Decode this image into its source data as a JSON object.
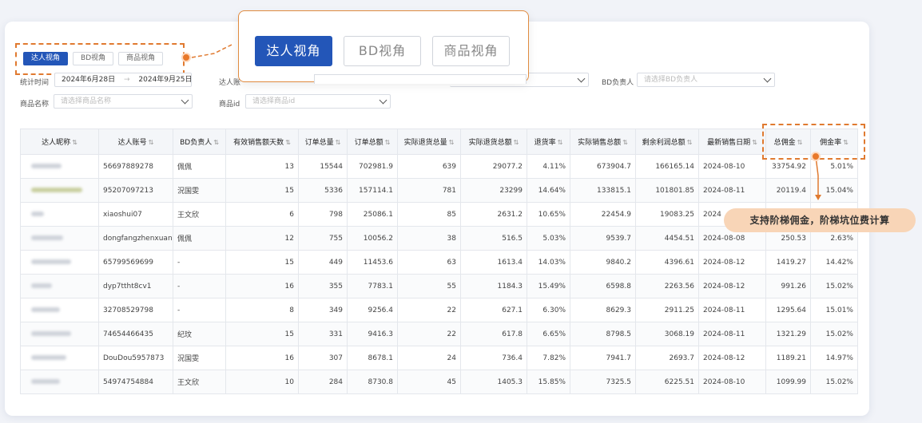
{
  "tabs": [
    {
      "label": "达人视角",
      "active": true
    },
    {
      "label": "BD视角",
      "active": false
    },
    {
      "label": "商品视角",
      "active": false
    }
  ],
  "filters": {
    "period_label": "统计时间",
    "start_date": "2024年6月28日",
    "arrow": "→",
    "end_date": "2024年9月25日",
    "talent_label": "达人账",
    "bd_label": "BD负责人",
    "bd_placeholder": "请选择BD负责人",
    "product_name_label": "商品名称",
    "product_name_placeholder": "请选择商品名称",
    "product_id_label": "商品id",
    "product_id_placeholder": "请选择商品id"
  },
  "table": {
    "headers": [
      "达人昵称",
      "达人账号",
      "BD负责人",
      "有效销售额天数",
      "订单总量",
      "订单总额",
      "实际退货总量",
      "实际退货总额",
      "退货率",
      "实际销售总额",
      "剩余利润总额",
      "最新销售日期",
      "总佣金",
      "佣金率"
    ],
    "rows": [
      [
        "56697889278",
        "佩佩",
        "13",
        "15544",
        "702981.9",
        "639",
        "29077.2",
        "4.11%",
        "673904.7",
        "166165.14",
        "2024-08-10",
        "33754.92",
        "5.01%"
      ],
      [
        "95207097213",
        "況国雯",
        "15",
        "5336",
        "157114.1",
        "781",
        "23299",
        "14.64%",
        "133815.1",
        "101801.85",
        "2024-08-11",
        "20119.4",
        "15.04%"
      ],
      [
        "xiaoshui07",
        "王文欣",
        "6",
        "798",
        "25086.1",
        "85",
        "2631.2",
        "10.65%",
        "22454.9",
        "19083.25",
        "2024",
        "",
        ""
      ],
      [
        "dongfangzhenxuan",
        "佩佩",
        "12",
        "755",
        "10056.2",
        "38",
        "516.5",
        "5.03%",
        "9539.7",
        "4454.51",
        "2024-08-08",
        "250.53",
        "2.63%"
      ],
      [
        "65799569699",
        "-",
        "15",
        "449",
        "11453.6",
        "63",
        "1613.4",
        "14.03%",
        "9840.2",
        "4396.61",
        "2024-08-12",
        "1419.27",
        "14.42%"
      ],
      [
        "dyp7ttht8cv1",
        "-",
        "16",
        "355",
        "7783.1",
        "55",
        "1184.3",
        "15.49%",
        "6598.8",
        "2263.56",
        "2024-08-12",
        "991.26",
        "15.02%"
      ],
      [
        "32708529798",
        "-",
        "8",
        "349",
        "9256.4",
        "22",
        "627.1",
        "6.30%",
        "8629.3",
        "2911.25",
        "2024-08-11",
        "1295.64",
        "15.01%"
      ],
      [
        "74654466435",
        "纪玟",
        "15",
        "331",
        "9416.3",
        "22",
        "617.8",
        "6.65%",
        "8798.5",
        "3068.19",
        "2024-08-11",
        "1321.29",
        "15.02%"
      ],
      [
        "DouDou5957873",
        "況国雯",
        "16",
        "307",
        "8678.1",
        "24",
        "736.4",
        "7.82%",
        "7941.7",
        "2693.7",
        "2024-08-12",
        "1189.21",
        "14.97%"
      ],
      [
        "54974754884",
        "王文欣",
        "10",
        "284",
        "8730.8",
        "45",
        "1405.3",
        "15.85%",
        "7325.5",
        "6225.51",
        "2024-08-10",
        "1099.99",
        "15.02%"
      ]
    ]
  },
  "annotation": "支持阶梯佣金，阶梯坑位费计算",
  "colors": {
    "primary": "#2356b8",
    "accent": "#e8782a",
    "bubble": "#f8d5b7"
  }
}
